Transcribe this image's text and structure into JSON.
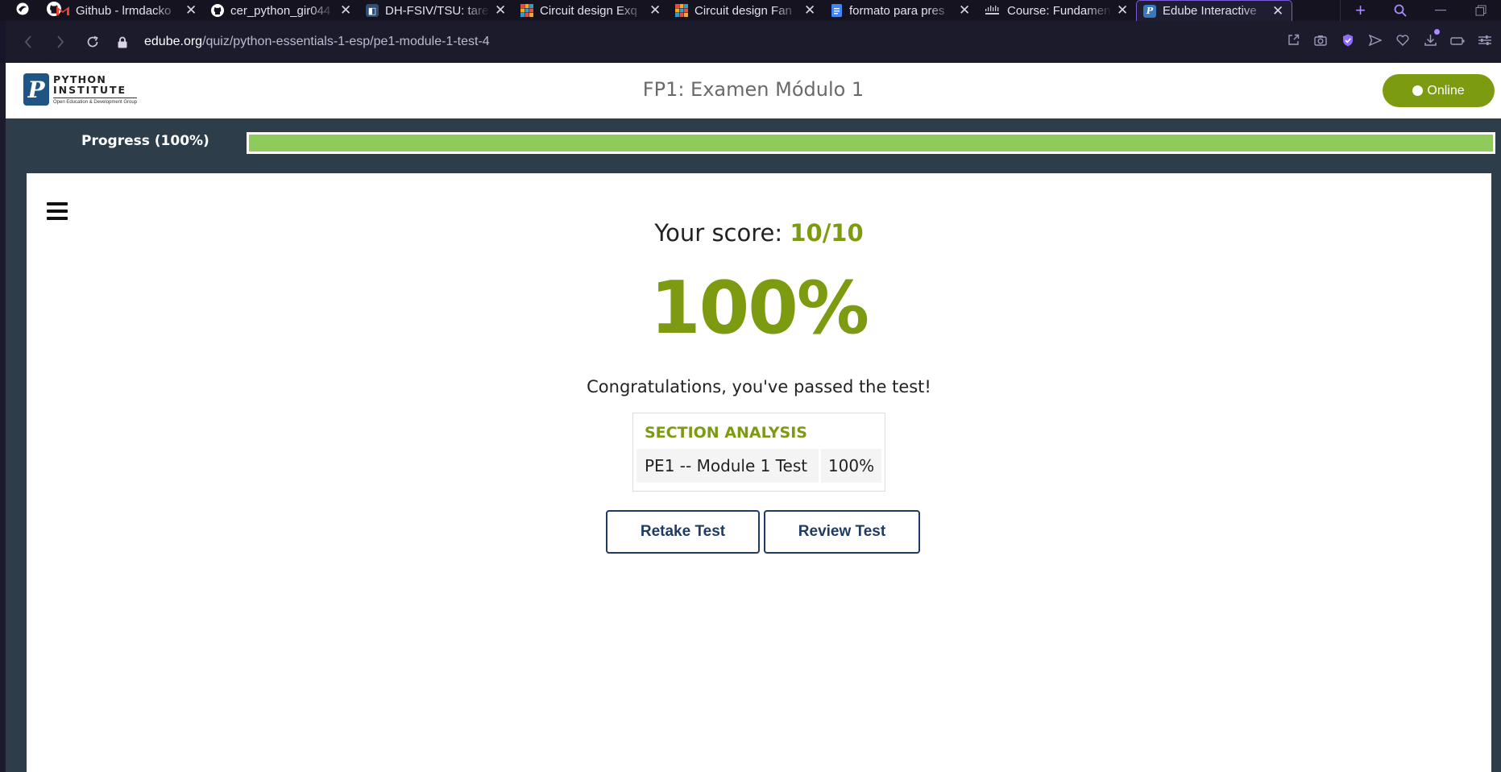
{
  "browser": {
    "tabs": [
      {
        "title": "",
        "icon": "github-icon",
        "color": "#ffffff"
      },
      {
        "title": "Github - lrmdacko",
        "icon": "gmail-icon",
        "color": "#ea4335"
      },
      {
        "title": "cer_python_gir044",
        "icon": "github-icon",
        "color": "#ffffff"
      },
      {
        "title": "DH-FSIV/TSU: tare",
        "icon": "repo-icon",
        "color": "#6fa8dc"
      },
      {
        "title": "Circuit design Exq",
        "icon": "tinkercad-icon",
        "color": "#e94b3c"
      },
      {
        "title": "Circuit design Fan",
        "icon": "tinkercad-icon",
        "color": "#e94b3c"
      },
      {
        "title": "formato para pres",
        "icon": "docs-icon",
        "color": "#4285f4"
      },
      {
        "title": "Course: Fundamen",
        "icon": "cisco-icon",
        "color": "#cccccc"
      },
      {
        "title": "Edube Interactive",
        "icon": "python-institute-icon",
        "color": "#3b78b9",
        "active": true
      }
    ],
    "url_domain": "edube.org",
    "url_path": "/quiz/python-essentials-1-esp/pe1-module-1-test-4"
  },
  "header": {
    "logo_line1": "PYTHON",
    "logo_line2": "INSTITUTE",
    "logo_line3": "Open Education & Development Group",
    "title": "FP1: Examen Módulo 1",
    "online_label": "Online"
  },
  "progress": {
    "label": "Progress (100%)",
    "value": 1.0
  },
  "result": {
    "score_prefix": "Your score: ",
    "score_value": "10/10",
    "percent": "100%",
    "message": "Congratulations, you've passed the test!"
  },
  "analysis": {
    "title": "SECTION ANALYSIS",
    "rows": [
      {
        "name": "PE1 -- Module 1 Test",
        "value": "100%"
      }
    ]
  },
  "actions": {
    "retake_label": "Retake Test",
    "review_label": "Review Test"
  },
  "colors": {
    "accent_green": "#7d9b11",
    "progress_green": "#8ecb5b",
    "navy": "#1f3b63",
    "page_bg": "#2d3e4a"
  }
}
